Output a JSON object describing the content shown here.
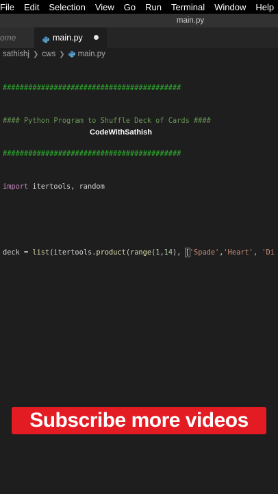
{
  "menubar": {
    "items": [
      "File",
      "Edit",
      "Selection",
      "View",
      "Go",
      "Run",
      "Terminal",
      "Window",
      "Help"
    ]
  },
  "titlebar": {
    "title": "main.py"
  },
  "tabs": {
    "previous_label": "ome",
    "active_label": "main.py"
  },
  "breadcrumb": {
    "items": [
      "sathishj",
      "cws",
      "main.py"
    ]
  },
  "code": {
    "line1": "##########################################",
    "line2": "#### Python Program to Shuffle Deck of Cards ####",
    "line3": "##########################################",
    "line4_kw": "import",
    "line4_rest": " itertools, random",
    "line6_var": "deck = ",
    "line6_list": "list",
    "line6_a": "(itertools.",
    "line6_product": "product",
    "line6_b": "(",
    "line6_range": "range",
    "line6_c": "(",
    "line6_n1": "1",
    "line6_comma": ",",
    "line6_n2": "14",
    "line6_d": "), ",
    "line6_bracket": "[",
    "line6_s1": "'Spade'",
    "line6_e": ",",
    "line6_s2": "'Heart'",
    "line6_f": ", ",
    "line6_s3": "'Di"
  },
  "watermark": "CodeWithSathish",
  "banner": "Subscribe more videos",
  "colors": {
    "banner_bg": "#e31b23",
    "editor_bg": "#1e1e1e",
    "comment": "#6a9955",
    "keyword": "#c586c0",
    "string": "#ce9178"
  }
}
